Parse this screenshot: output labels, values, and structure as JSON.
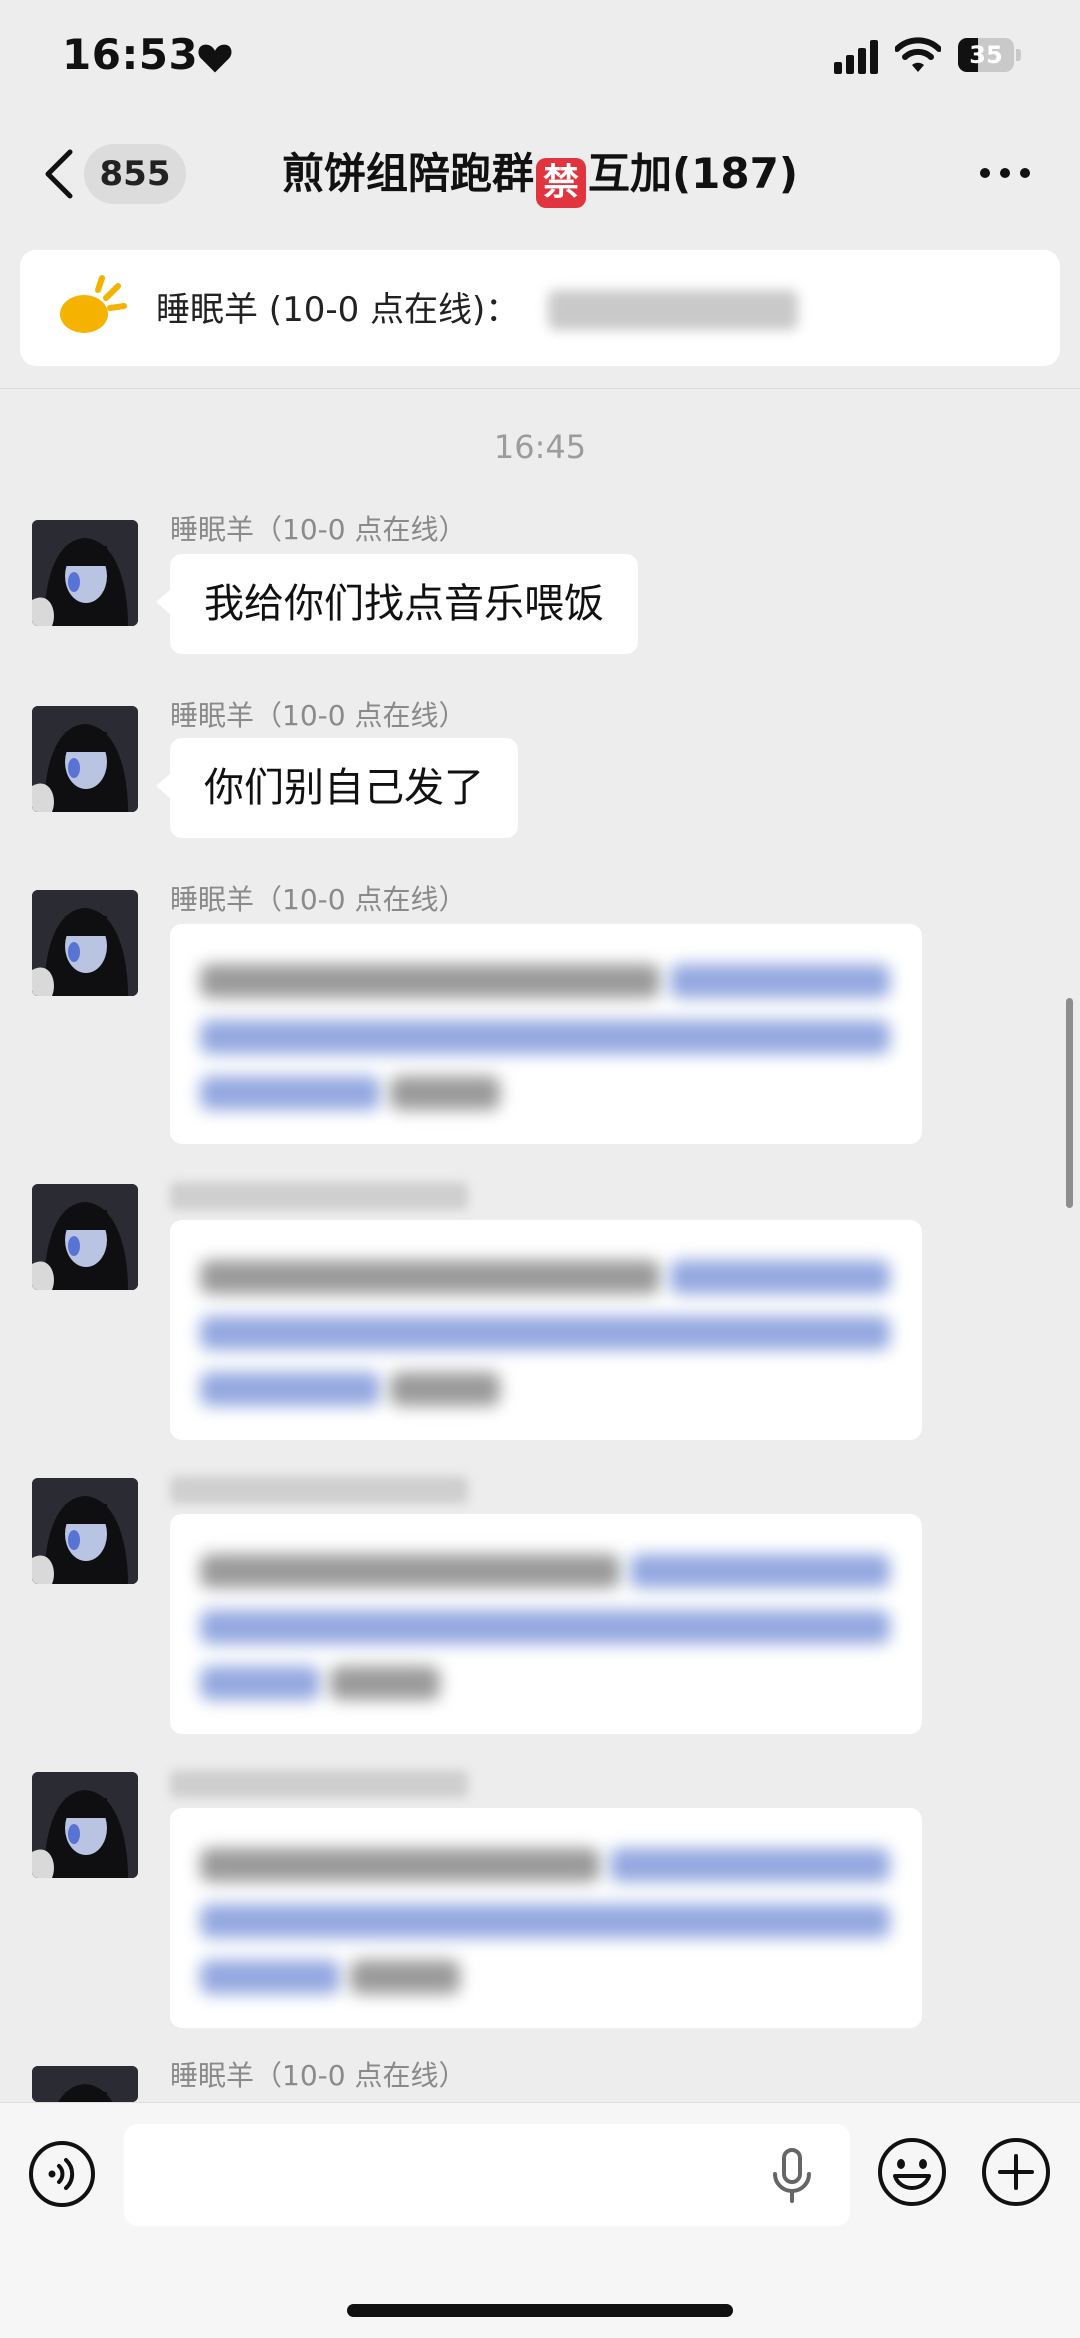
{
  "status_bar": {
    "time": "16:53",
    "battery_level": "35",
    "battery_fraction": 0.35,
    "icons": [
      "heart-icon",
      "cellular-signal-icon",
      "wifi-icon",
      "battery-icon"
    ]
  },
  "nav": {
    "back_icon": "chevron-left-icon",
    "unread_count": "855",
    "title_before": "煎饼组陪跑群",
    "title_emoji": "禁",
    "title_after": "互加(187)",
    "more_icon": "more-horizontal-icon"
  },
  "pinned_notice": {
    "icon": "megaphone-icon",
    "text": "睡眠羊 (10-0 点在线)：",
    "accent_color": "#f5b300"
  },
  "chat": {
    "timestamp": "16:45",
    "messages": [
      {
        "sender": "睡眠羊（10-0 点在线）",
        "type": "text",
        "text": "我给你们找点音乐喂饭"
      },
      {
        "sender": "睡眠羊（10-0 点在线）",
        "type": "text",
        "text": "你们别自己发了"
      },
      {
        "sender": "睡眠羊（10-0 点在线）",
        "type": "link"
      },
      {
        "sender": "",
        "type": "link"
      },
      {
        "sender": "",
        "type": "link"
      },
      {
        "sender": "",
        "type": "link"
      },
      {
        "sender": "睡眠羊（10-0 点在线）",
        "type": "partial"
      }
    ]
  },
  "input_bar": {
    "voice_icon": "voice-input-icon",
    "mic_icon": "microphone-icon",
    "emoji_icon": "emoji-icon",
    "plus_icon": "plus-circle-icon",
    "text_value": ""
  }
}
